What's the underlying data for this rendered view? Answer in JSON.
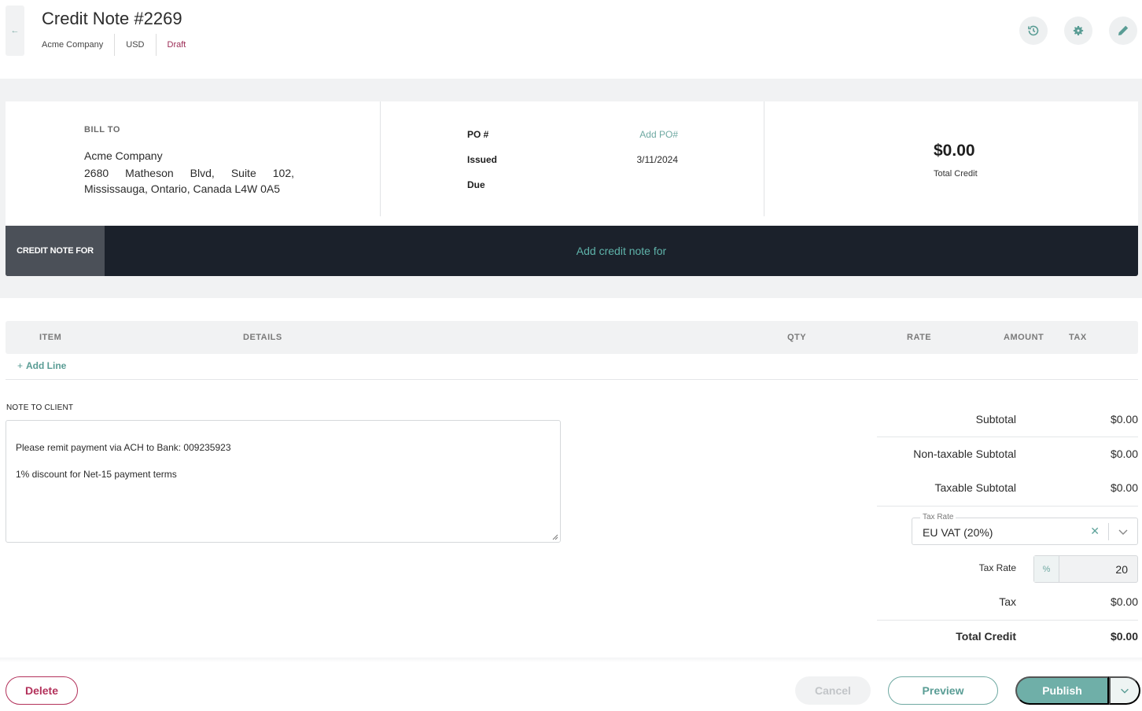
{
  "header": {
    "title": "Credit Note #2269",
    "company": "Acme Company",
    "currency": "USD",
    "status": "Draft",
    "icons": [
      "history-icon",
      "gear-icon",
      "pencil-icon"
    ]
  },
  "bill_to": {
    "label": "BILL TO",
    "name": "Acme Company",
    "address": "2680 Matheson Blvd, Suite 102, Mississauga, Ontario, Canada L4W 0A5"
  },
  "details": {
    "po_label": "PO #",
    "po_action": "Add PO#",
    "issued_label": "Issued",
    "issued_value": "3/11/2024",
    "due_label": "Due"
  },
  "total": {
    "amount": "$0.00",
    "label": "Total Credit"
  },
  "credit_note_for": {
    "label": "CREDIT NOTE FOR",
    "action": "Add credit note for"
  },
  "items": {
    "columns": {
      "item": "ITEM",
      "details": "DETAILS",
      "qty": "QTY",
      "rate": "RATE",
      "amount": "AMOUNT",
      "tax": "TAX"
    },
    "add_line": "Add Line"
  },
  "note": {
    "label": "NOTE TO CLIENT",
    "text": "Please remit payment via ACH to Bank: 009235923\n\n1% discount for Net-15 payment terms"
  },
  "totals": {
    "subtotal_label": "Subtotal",
    "subtotal": "$0.00",
    "nontaxable_label": "Non-taxable Subtotal",
    "nontaxable": "$0.00",
    "taxable_label": "Taxable Subtotal",
    "taxable": "$0.00",
    "tax_select_legend": "Tax Rate",
    "tax_select_value": "EU VAT (20%)",
    "tax_rate_label": "Tax Rate",
    "tax_rate_unit": "%",
    "tax_rate_value": "20",
    "tax_label": "Tax",
    "tax": "$0.00",
    "total_label": "Total Credit",
    "total": "$0.00"
  },
  "footer": {
    "delete": "Delete",
    "cancel": "Cancel",
    "preview": "Preview",
    "publish": "Publish"
  },
  "colors": {
    "accent": "#6fafa8",
    "danger": "#b3325b",
    "dark_bar": "#1b212b"
  }
}
